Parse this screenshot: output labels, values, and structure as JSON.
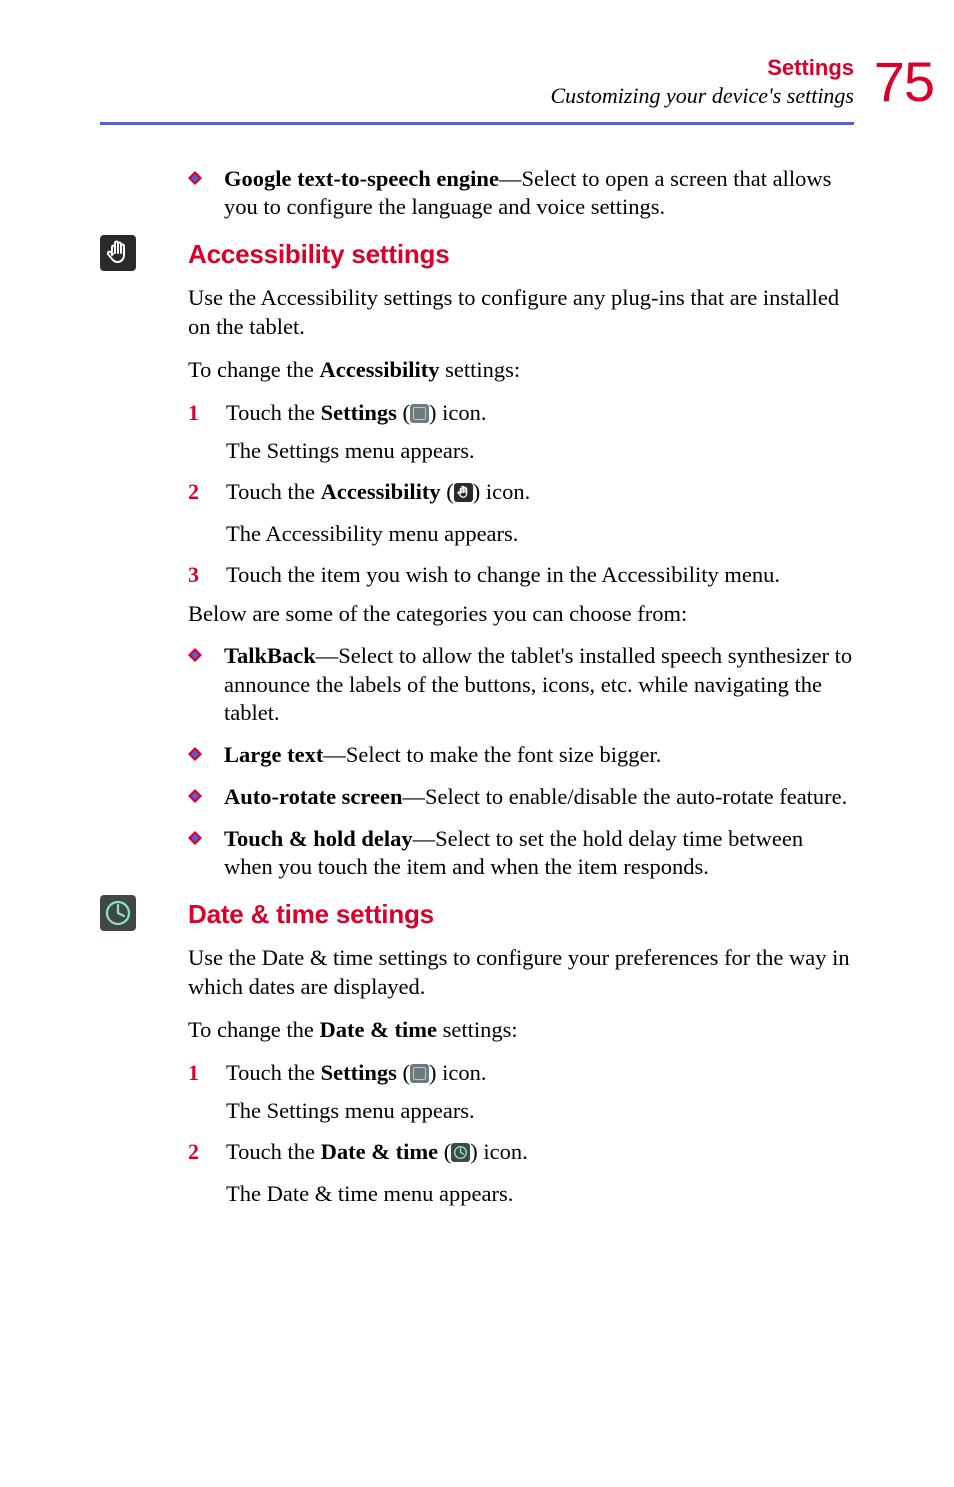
{
  "header": {
    "title_line1": "Settings",
    "title_line2": "Customizing your device's settings",
    "page_number": "75"
  },
  "top_bullet": {
    "bold": "Google text-to-speech engine",
    "rest": "—Select to open a screen that allows you to configure the language and voice settings."
  },
  "accessibility": {
    "heading": "Accessibility settings",
    "p1": "Use the Accessibility settings to configure any plug-ins that are installed on the tablet.",
    "p2_pre": "To change the ",
    "p2_bold": "Accessibility",
    "p2_post": " settings:",
    "steps": {
      "s1": {
        "num": "1",
        "pre": "Touch the ",
        "bold": "Settings",
        "mid": " (",
        "post": ") icon."
      },
      "s1_after": "The Settings menu appears.",
      "s2": {
        "num": "2",
        "pre": "Touch the ",
        "bold": "Accessibility",
        "mid": " (",
        "post": ") icon."
      },
      "s2_after": "The Accessibility menu appears.",
      "s3": {
        "num": "3",
        "text": "Touch the item you wish to change in the Accessibility menu."
      }
    },
    "below_intro": "Below are some of the categories you can choose from:",
    "bullets": {
      "b1": {
        "bold": "TalkBack",
        "rest": "—Select to allow the tablet's installed speech synthesizer to announce the labels of the buttons, icons, etc. while navigating the tablet."
      },
      "b2": {
        "bold": "Large text",
        "rest": "—Select to make the font size bigger."
      },
      "b3": {
        "bold": "Auto-rotate screen",
        "rest": "—Select to enable/disable the auto-rotate feature."
      },
      "b4": {
        "bold": "Touch & hold delay",
        "rest": "—Select to set the hold delay time between when you touch the item and when the item responds."
      }
    }
  },
  "datetime": {
    "heading": "Date & time settings",
    "p1": "Use the Date & time settings to configure your preferences for the way in which dates are displayed.",
    "p2_pre": "To change the ",
    "p2_bold": "Date & time",
    "p2_post": " settings:",
    "steps": {
      "s1": {
        "num": "1",
        "pre": "Touch the ",
        "bold": "Settings",
        "mid": " (",
        "post": ") icon."
      },
      "s1_after": "The Settings menu appears.",
      "s2": {
        "num": "2",
        "pre": "Touch the ",
        "bold": "Date & time",
        "mid": " (",
        "post": ") icon."
      },
      "s2_after": "The Date & time menu appears."
    }
  }
}
